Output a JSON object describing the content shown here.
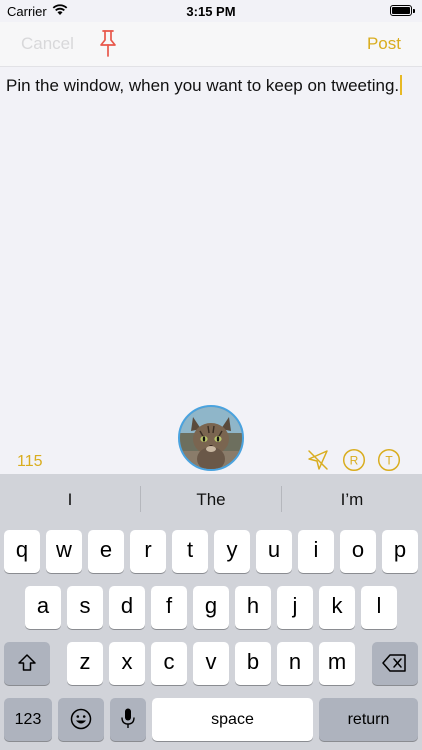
{
  "status_bar": {
    "carrier": "Carrier",
    "time": "3:15 PM"
  },
  "nav": {
    "cancel_label": "Cancel",
    "post_label": "Post"
  },
  "compose": {
    "text": "Pin the window, when you want to keep on tweeting."
  },
  "accessory": {
    "char_count": "115"
  },
  "keyboard": {
    "suggestions": [
      "I",
      "The",
      "I’m"
    ],
    "row1": [
      "q",
      "w",
      "e",
      "r",
      "t",
      "y",
      "u",
      "i",
      "o",
      "p"
    ],
    "row2": [
      "a",
      "s",
      "d",
      "f",
      "g",
      "h",
      "j",
      "k",
      "l"
    ],
    "row3": [
      "z",
      "x",
      "c",
      "v",
      "b",
      "n",
      "m"
    ],
    "numbers_label": "123",
    "space_label": "space",
    "return_label": "return"
  },
  "colors": {
    "accent": "#d9ad1f",
    "pin": "#e8574b",
    "avatar_ring": "#4aa3df"
  }
}
